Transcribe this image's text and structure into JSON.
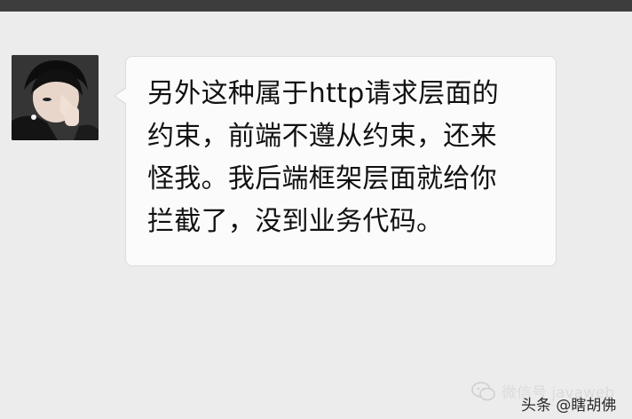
{
  "chat": {
    "message_lines": [
      "另外这种属于http请求层面的",
      "约束，前端不遵从约束，还来",
      "怪我。我后端框架层面就给你",
      "拦截了，没到业务代码。"
    ]
  },
  "watermark": {
    "icon": "wechat-icon",
    "wechat_text": "微信号 javaweb",
    "toutiao_text": "头条 @瞎胡佛"
  },
  "colors": {
    "background": "#ececec",
    "top_bar": "#3d3d3d",
    "bubble": "#fbfbfb",
    "bubble_border": "#dcdcdc",
    "text": "#111111"
  }
}
